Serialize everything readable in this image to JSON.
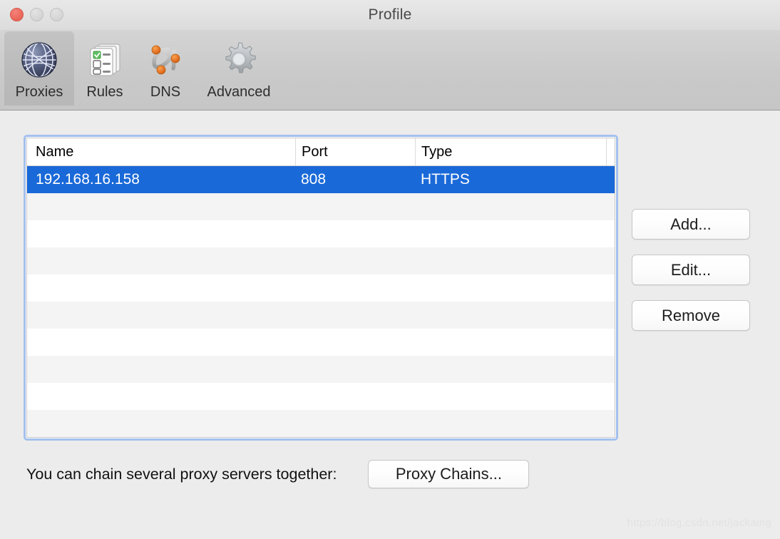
{
  "window": {
    "title": "Profile",
    "traffic_lights": [
      {
        "name": "close",
        "color": "#ed6a5e"
      },
      {
        "name": "minimize",
        "color": "#d6d6d6"
      },
      {
        "name": "maximize",
        "color": "#d6d6d6"
      }
    ]
  },
  "toolbar": {
    "tabs": [
      {
        "label": "Proxies",
        "icon": "globe-icon",
        "selected": true
      },
      {
        "label": "Rules",
        "icon": "documents-checklist-icon",
        "selected": false
      },
      {
        "label": "DNS",
        "icon": "network-nodes-icon",
        "selected": false
      },
      {
        "label": "Advanced",
        "icon": "gear-icon",
        "selected": false
      }
    ]
  },
  "table": {
    "columns": [
      "Name",
      "Port",
      "Type"
    ],
    "rows": [
      {
        "name": "192.168.16.158",
        "port": "808",
        "type": "HTTPS",
        "selected": true
      }
    ],
    "empty_row_count": 9,
    "selection_color": "#1a69d8",
    "focus_ring_color": "#a3c0ee"
  },
  "buttons": {
    "add": "Add...",
    "edit": "Edit...",
    "remove": "Remove",
    "proxy_chains": "Proxy Chains..."
  },
  "chain": {
    "text": "You can chain several proxy servers together:"
  },
  "watermark": "https://blog.csdn.net/jackaing"
}
